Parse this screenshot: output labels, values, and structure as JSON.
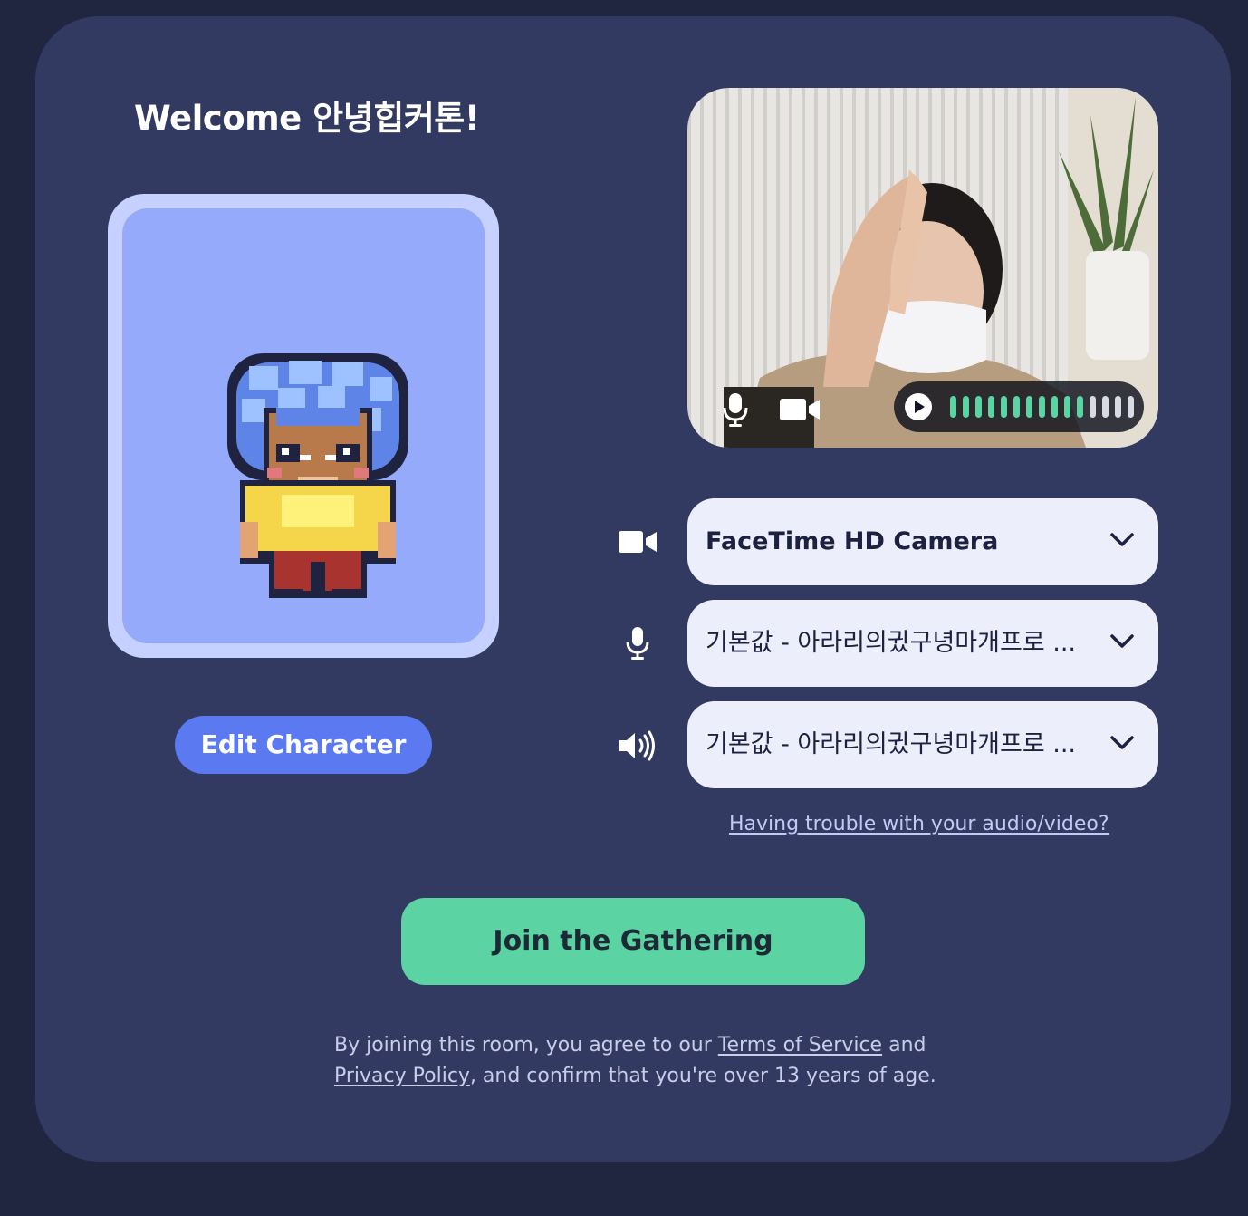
{
  "welcome": {
    "title": "Welcome 안녕힙커톤!"
  },
  "character": {
    "edit_label": "Edit Character"
  },
  "video_preview": {
    "mic_icon": "microphone-icon",
    "camera_icon": "video-camera-icon",
    "play_icon": "play-icon",
    "audio_level": 0.73
  },
  "devices": {
    "camera": {
      "icon": "video-camera-icon",
      "value": "FaceTime HD Camera"
    },
    "microphone": {
      "icon": "microphone-icon",
      "value": "기본값 - 아라리의귔구녕마개프로 ..."
    },
    "speaker": {
      "icon": "speaker-icon",
      "value": "기본값 - 아라리의귔구녕마개프로 ..."
    }
  },
  "trouble_link": "Having trouble with your audio/video?",
  "join_label": "Join the Gathering",
  "legal": {
    "prefix": "By joining this room, you agree to our ",
    "tos": "Terms of Service",
    "and": " and",
    "privacy": "Privacy Policy",
    "suffix": ", and confirm that you're over 13 years of age."
  },
  "colors": {
    "background": "#202540",
    "panel": "#333a61",
    "edit_button": "#5b79f0",
    "join_button": "#5cd3a2",
    "meter_active": "#5cd3a2",
    "meter_inactive": "#d8dbe6"
  }
}
